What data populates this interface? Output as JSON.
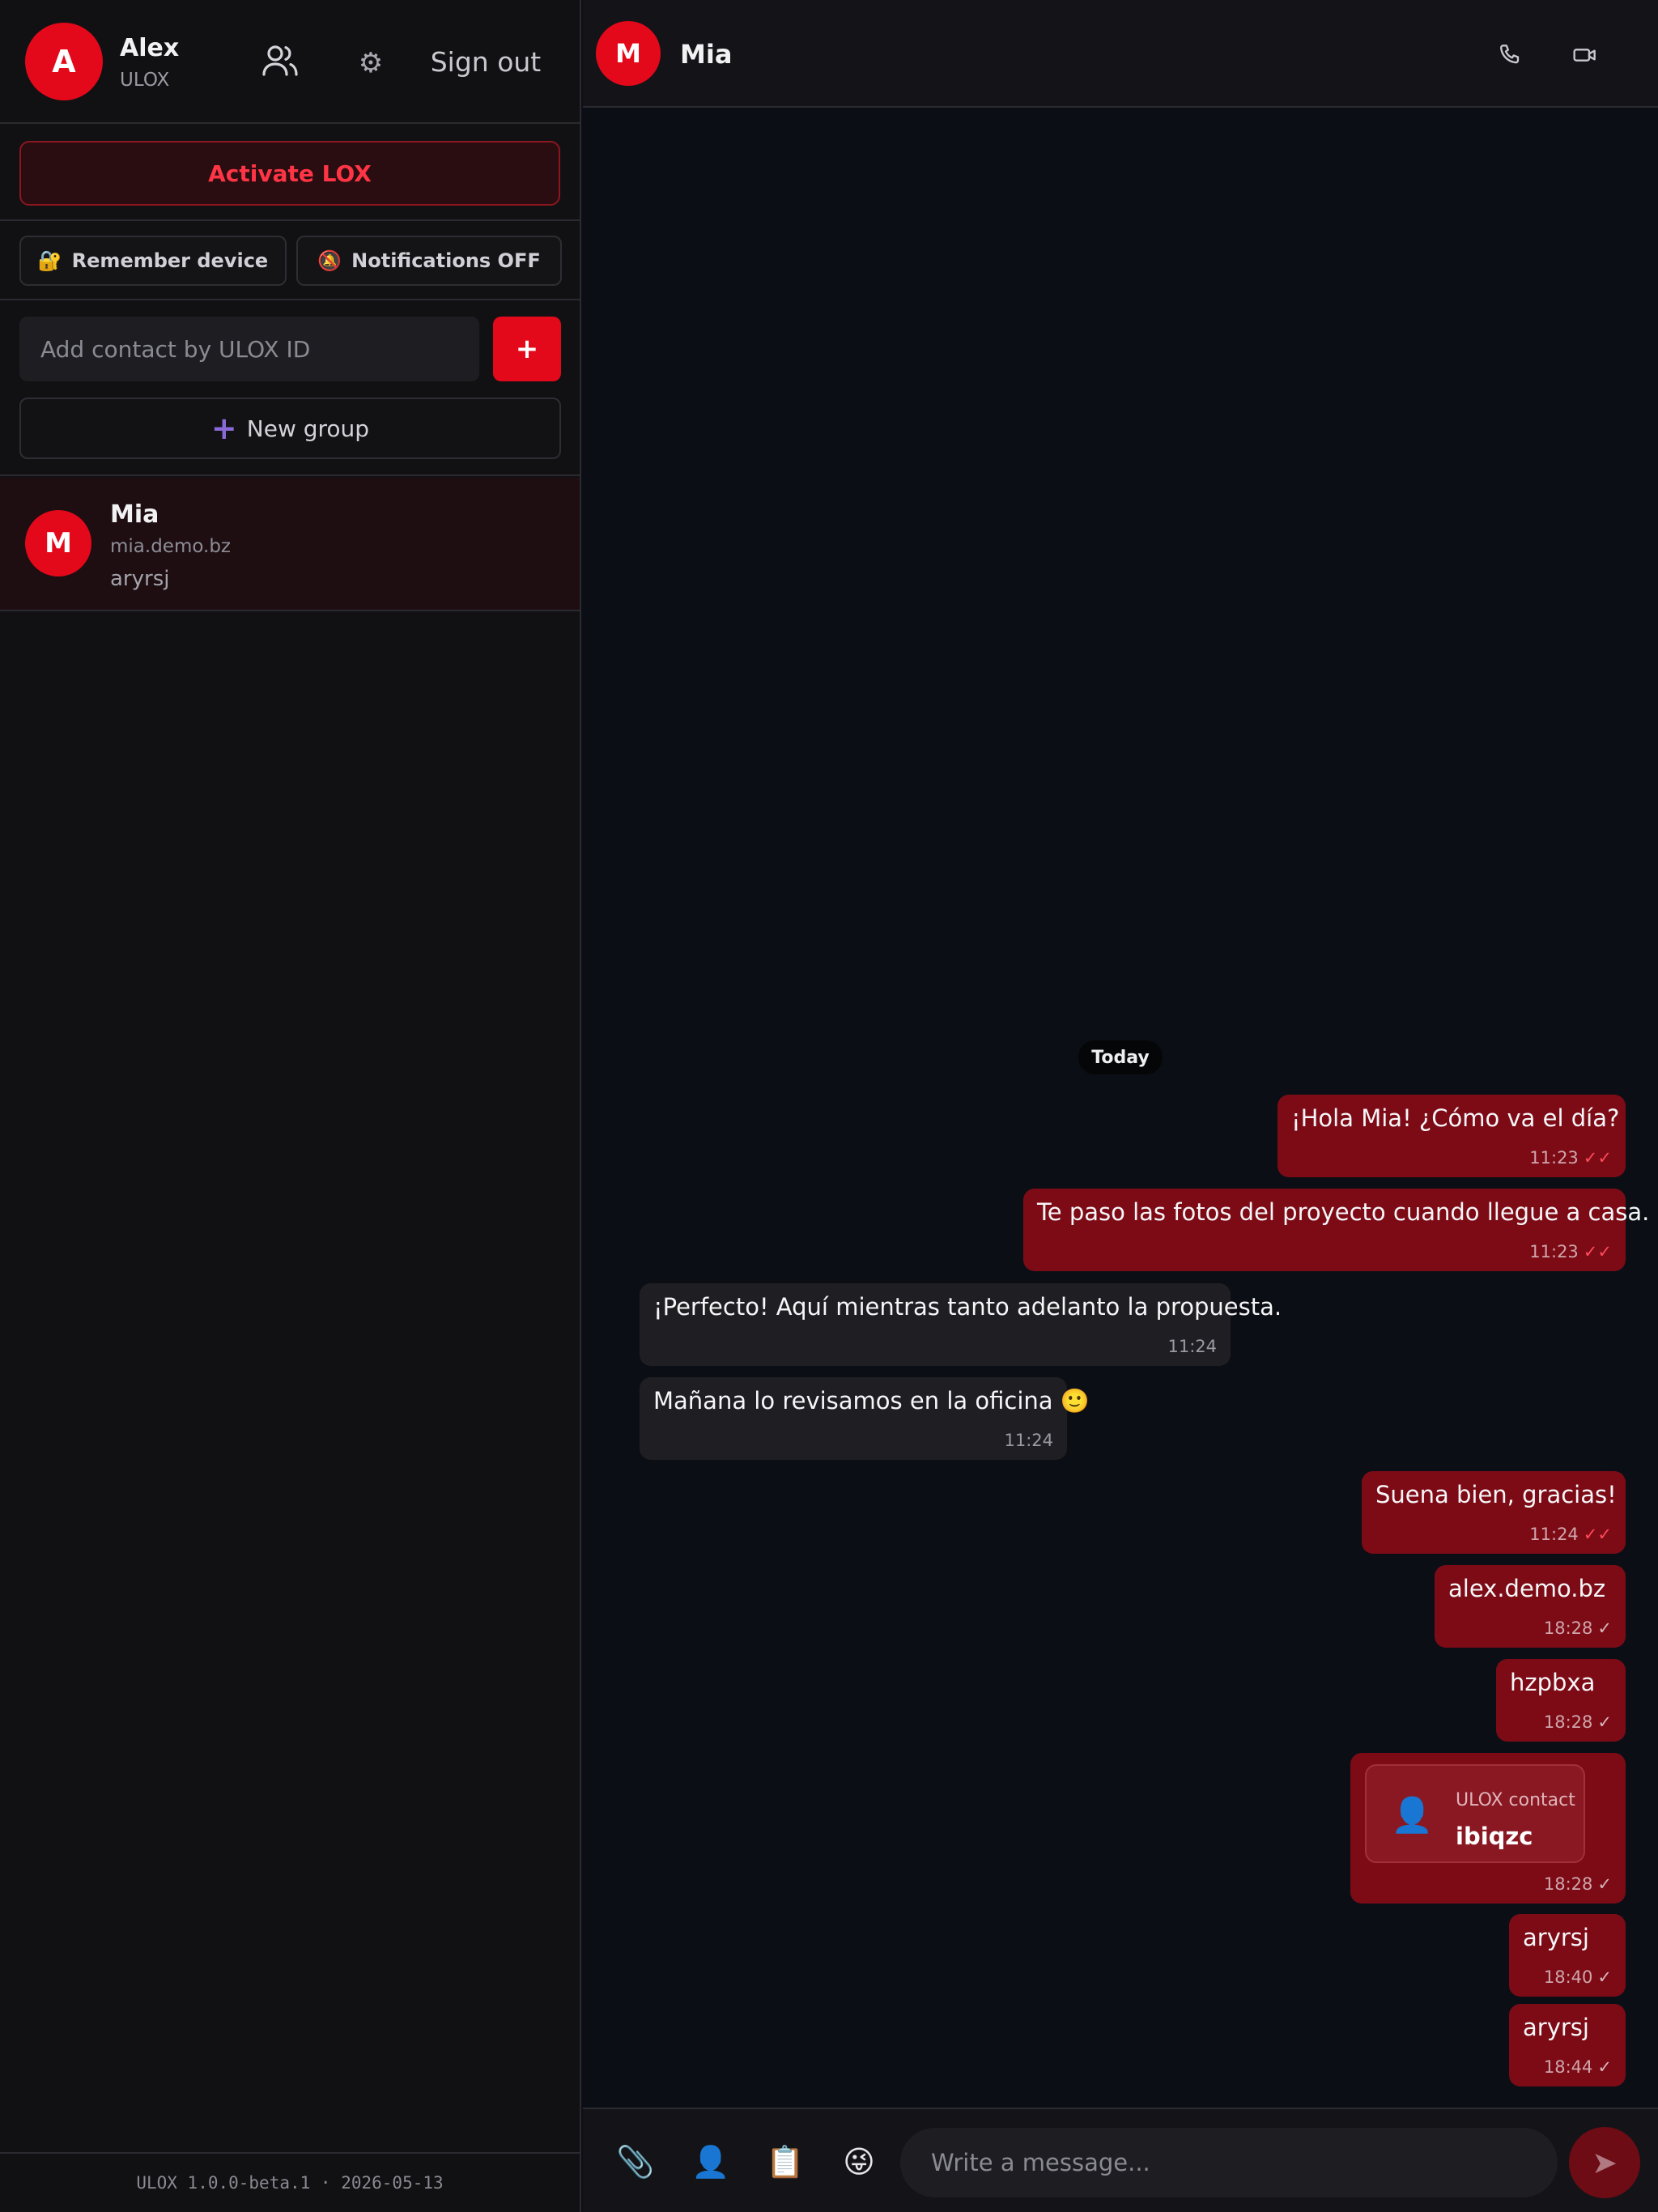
{
  "me": {
    "avatar_initial": "A",
    "name": "Alex",
    "subtitle": "ULOX",
    "signout_label": "Sign out"
  },
  "sidebar": {
    "activate_label": "Activate LOX",
    "remember_icon": "🔐",
    "remember_label": "Remember device",
    "notif_icon": "🔕",
    "notif_label": "Notifications OFF",
    "add_placeholder": "Add contact by ULOX ID",
    "add_button_label": "+",
    "new_group_icon": "+",
    "new_group_label": "New group",
    "chats": [
      {
        "avatar_initial": "M",
        "name": "Mia",
        "handle": "mia.demo.bz",
        "last_message": "aryrsj"
      }
    ],
    "footer": "ULOX 1.0.0-beta.1 · 2026-05-13"
  },
  "chat": {
    "contact": {
      "avatar_initial": "M",
      "name": "Mia"
    },
    "date_separator": "Today",
    "messages": [
      {
        "direction": "out",
        "text": "¡Hola Mia! ¿Cómo va el día?",
        "time": "11:23",
        "ticks": "✓✓"
      },
      {
        "direction": "out",
        "text": "Te paso las fotos del proyecto cuando llegue a casa.",
        "time": "11:23",
        "ticks": "✓✓"
      },
      {
        "direction": "in",
        "text": "¡Perfecto! Aquí mientras tanto adelanto la propuesta.",
        "time": "11:24"
      },
      {
        "direction": "in",
        "text": "Mañana lo revisamos en la oficina 🙂",
        "time": "11:24"
      },
      {
        "direction": "out",
        "text": "Suena bien, gracias!",
        "time": "11:24",
        "ticks": "✓✓"
      },
      {
        "direction": "out",
        "text": "alex.demo.bz",
        "time": "18:28",
        "ticks": "✓"
      },
      {
        "direction": "out",
        "text": "hzpbxa",
        "time": "18:28",
        "ticks": "✓"
      },
      {
        "direction": "out",
        "type": "contact",
        "card_label": "ULOX contact",
        "card_id": "ibiqzc",
        "time": "18:28",
        "ticks": "✓"
      },
      {
        "direction": "out",
        "text": "aryrsj",
        "time": "18:40",
        "ticks": "✓"
      },
      {
        "direction": "out",
        "text": "aryrsj",
        "time": "18:44",
        "ticks": "✓"
      }
    ],
    "contact_card_icon": "👤",
    "composer": {
      "attach_icon": "📎",
      "contact_icon": "👤",
      "clipboard_icon": "📋",
      "emoji_icon": "😜",
      "placeholder": "Write a message...",
      "send_icon": "➤"
    }
  }
}
